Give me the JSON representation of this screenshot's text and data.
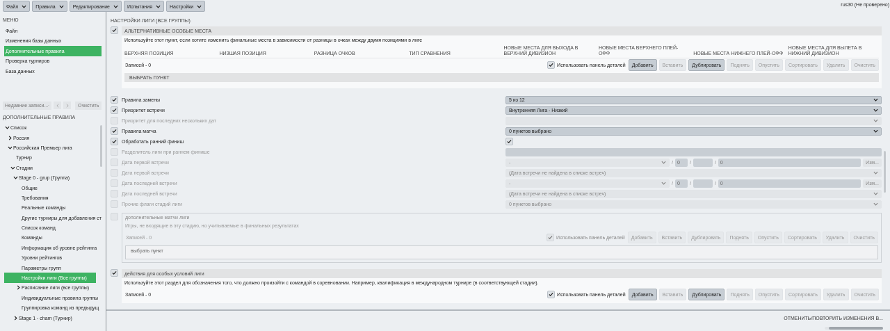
{
  "menubar": [
    {
      "label": "Файл"
    },
    {
      "label": "Правила"
    },
    {
      "label": "Редактирование"
    },
    {
      "label": "Испытания"
    },
    {
      "label": "Настройки"
    }
  ],
  "user_status": "rus30 (Не проверено)",
  "sidebar": {
    "menu_title": "МЕНЮ",
    "items": [
      {
        "label": "Файл",
        "selected": false
      },
      {
        "label": "Изменения базы данных",
        "selected": false
      },
      {
        "label": "Дополнительные правила",
        "selected": true
      },
      {
        "label": "Проверка турниров",
        "selected": false
      },
      {
        "label": "База данных",
        "selected": false
      }
    ],
    "recent": {
      "placeholder": "Недавние записи...",
      "clear_button": "Очистить"
    },
    "tree_title": "ДОПОЛНИТЕЛЬНЫЕ ПРАВИЛА",
    "tree": [
      {
        "label": "Список",
        "expanded": true,
        "selected": false,
        "children": [
          {
            "label": "Россия",
            "expanded": false,
            "selected": false
          },
          {
            "label": "Российская Премьер лига",
            "expanded": true,
            "selected": false,
            "children": [
              {
                "label": "Турнир",
                "selected": false
              },
              {
                "label": "Стадии",
                "expanded": true,
                "selected": false,
                "children": [
                  {
                    "label": "Stage 0 - grup (Группа)",
                    "expanded": true,
                    "selected": false,
                    "children": [
                      {
                        "label": "Общие",
                        "selected": false
                      },
                      {
                        "label": "Требования",
                        "selected": false
                      },
                      {
                        "label": "Реальные команды",
                        "selected": false
                      },
                      {
                        "label": "Другие турниры для добавления ст",
                        "selected": false
                      },
                      {
                        "label": "Список команд",
                        "selected": false
                      },
                      {
                        "label": "Команды",
                        "selected": false
                      },
                      {
                        "label": "Информация об уровне рейтинга",
                        "selected": false
                      },
                      {
                        "label": "Уровни рейтингов",
                        "selected": false
                      },
                      {
                        "label": "Параметры групп",
                        "selected": false
                      },
                      {
                        "label": "Настройки лиги (Все группы)",
                        "selected": true
                      },
                      {
                        "label": "Расписание лиги (все группы)",
                        "expanded": false,
                        "selected": false
                      },
                      {
                        "label": "Индивидуальные правила группы",
                        "selected": false
                      },
                      {
                        "label": "Группировка команд из предыдущ",
                        "selected": false
                      }
                    ]
                  },
                  {
                    "label": "Stage 1 - cham (Турнир)",
                    "expanded": false,
                    "selected": false
                  }
                ]
              }
            ]
          }
        ]
      }
    ]
  },
  "main": {
    "title": "НАСТРОЙКИ ЛИГИ (ВСЕ ГРУППЫ)",
    "alt_places": {
      "checked": true,
      "disabled": false,
      "title": "АЛЬТЕРНАТИВНЫЕ ОСОБЫЕ МЕСТА",
      "description": "Используйте этот пункт, если хотите изменить финальные места в зависимости от разницы в очках между двумя позициями в лиге",
      "columns": [
        "ВЕРХНЯЯ ПОЗИЦИЯ",
        "НИЗШАЯ ПОЗИЦИЯ",
        "РАЗНИЦА ОЧКОВ",
        "ТИП СРАВНЕНИЯ",
        "НОВЫЕ МЕСТА ДЛЯ ВЫХОДА В ВЕРХНИЙ ДИВИЗИОН",
        "НОВЫЕ МЕСТА ВЕРХНЕГО ПЛЕЙ-ОФФ",
        "НОВЫЕ МЕСТА НИЖНЕГО ПЛЕЙ-ОФФ",
        "НОВЫЕ МЕСТА ДЛЯ ВЫЛЕТА В НИЖНИЙ ДИВИЗИОН"
      ],
      "records": "Записей - 0",
      "use_details": {
        "label": "Использовать панель деталей",
        "checked": true
      },
      "buttons": [
        {
          "label": "Добавить",
          "disabled": false
        },
        {
          "label": "Вставить",
          "disabled": true
        },
        {
          "label": "Дублировать",
          "disabled": false
        },
        {
          "label": "Поднять",
          "disabled": true
        },
        {
          "label": "Опустить",
          "disabled": true
        },
        {
          "label": "Сортировать",
          "disabled": true
        },
        {
          "label": "Удалить",
          "disabled": true
        },
        {
          "label": "Очистить",
          "disabled": true
        }
      ],
      "select_hint": "ВЫБРАТЬ ПУНКТ"
    },
    "rows": [
      {
        "label": "Правила замены",
        "checked": true,
        "disabled": false,
        "kind": "select",
        "value": "5 из 12"
      },
      {
        "label": "Приоритет встречи",
        "checked": true,
        "disabled": false,
        "kind": "select",
        "value": "Внутренняя Лига - Низкий"
      },
      {
        "label": "Приоритет для последних нескольких дат",
        "checked": false,
        "disabled": true,
        "kind": "select"
      },
      {
        "label": "Правила матча",
        "checked": true,
        "disabled": false,
        "kind": "select",
        "value": "0 пунктов выбрано"
      },
      {
        "label": "Обработать ранний финиш",
        "checked": true,
        "disabled": false,
        "kind": "checkbox",
        "value_checked": true
      },
      {
        "label": "Разделитель лиги при раннем финише",
        "checked": false,
        "disabled": true,
        "kind": "input"
      },
      {
        "label": "Дата первой встречи",
        "checked": false,
        "disabled": true,
        "kind": "datetime",
        "date": "-",
        "separators": [
          "/",
          "/",
          "/"
        ],
        "hour": "0",
        "value": "0",
        "button": "Изм..."
      },
      {
        "label": "Дата первой встречи",
        "checked": false,
        "disabled": true,
        "kind": "select",
        "value": "(Дата встречи не найдена в списке встреч)"
      },
      {
        "label": "Дата последней встречи",
        "checked": false,
        "disabled": true,
        "kind": "datetime",
        "date": "-",
        "separators": [
          "/",
          "/",
          "/"
        ],
        "hour": "0",
        "value": "0",
        "button": "Изм..."
      },
      {
        "label": "Дата последней встречи",
        "checked": false,
        "disabled": true,
        "kind": "select",
        "value": "(Дата встречи не найдена в списке встреч)"
      },
      {
        "label": "Прочие флаги стадий лиги",
        "checked": false,
        "disabled": true,
        "kind": "select",
        "value": "0 пунктов выбрано"
      }
    ],
    "extra_matches": {
      "checked": false,
      "disabled": true,
      "title": "дополнительные матчи лиги",
      "description": "Игры, не входящие в эту стадию, но учитываемые в финальных результатах",
      "records": "Записей - 0",
      "use_details": {
        "label": "Использовать панель деталей",
        "checked": true
      },
      "buttons": [
        {
          "label": "Добавить",
          "disabled": true
        },
        {
          "label": "Вставить",
          "disabled": true
        },
        {
          "label": "Дублировать",
          "disabled": true
        },
        {
          "label": "Поднять",
          "disabled": true
        },
        {
          "label": "Опустить",
          "disabled": true
        },
        {
          "label": "Сортировать",
          "disabled": true
        },
        {
          "label": "Удалить",
          "disabled": true
        },
        {
          "label": "Очистить",
          "disabled": true
        }
      ],
      "select_hint": "выбрать пункт"
    },
    "special_actions": {
      "checked": true,
      "disabled": false,
      "title": "действия для особых условий лиги",
      "description": "Используйте этот раздел для обозначения того, что должно произойти с командой в соревновании. Например, квалификация в международном турнире (в соответствующей стадии).",
      "records": "Записей - 0",
      "use_details": {
        "label": "Использовать панель деталей",
        "checked": true
      },
      "buttons": [
        {
          "label": "Добавить",
          "disabled": false
        },
        {
          "label": "Вставить",
          "disabled": true
        },
        {
          "label": "Дублировать",
          "disabled": false
        },
        {
          "label": "Поднять",
          "disabled": true
        },
        {
          "label": "Опустить",
          "disabled": true
        },
        {
          "label": "Сортировать",
          "disabled": true
        },
        {
          "label": "Удалить",
          "disabled": true
        },
        {
          "label": "Очистить",
          "disabled": true
        }
      ]
    }
  },
  "status_bar": {
    "undo_redo": "ОТМЕНИТЬ/ПОВТОРИТЬ ИЗМЕНЕНИЯ В..."
  }
}
